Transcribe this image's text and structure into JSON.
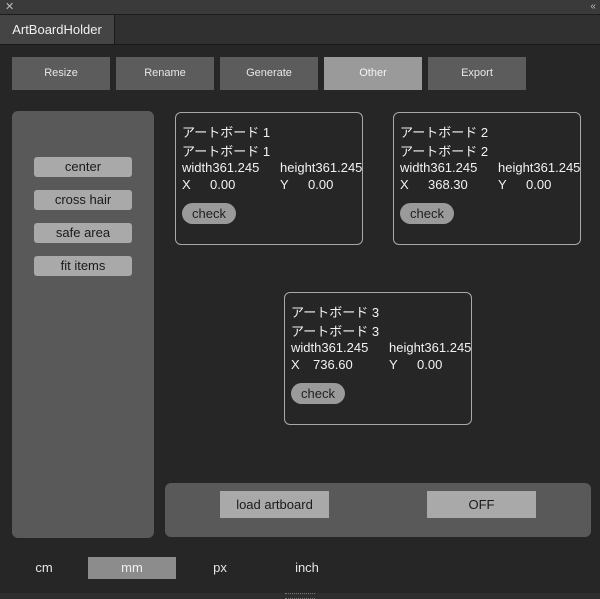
{
  "window": {
    "close_glyph": "✕",
    "collapse_glyph": "‹‹"
  },
  "panel_title": "ArtBoardHolder",
  "top_buttons": [
    "Resize",
    "Rename",
    "Generate",
    "Other",
    "Export"
  ],
  "active_top": "Other",
  "sidebar": [
    "center",
    "cross hair",
    "safe area",
    "fit items"
  ],
  "artboards": [
    {
      "title": "アートボード 1",
      "name": "アートボード 1",
      "width_label": "width361.245",
      "height_label": "height361.245",
      "x_label": "X",
      "x_value": "0.00",
      "y_label": "Y",
      "y_value": "0.00",
      "check": "check"
    },
    {
      "title": "アートボード 2",
      "name": "アートボード 2",
      "width_label": "width361.245",
      "height_label": "height361.245",
      "x_label": "X",
      "x_value": "368.30",
      "y_label": "Y",
      "y_value": "0.00",
      "check": "check"
    },
    {
      "title": "アートボード 3",
      "name": "アートボード 3",
      "width_label": "width361.245",
      "height_label": "height361.245",
      "x_label": "X",
      "x_value": "736.60",
      "y_label": "Y",
      "y_value": "0.00",
      "check": "check"
    }
  ],
  "bottom": {
    "load": "load artboard",
    "toggle": "OFF"
  },
  "units": [
    "cm",
    "mm",
    "px",
    "inch"
  ],
  "active_unit": "mm"
}
